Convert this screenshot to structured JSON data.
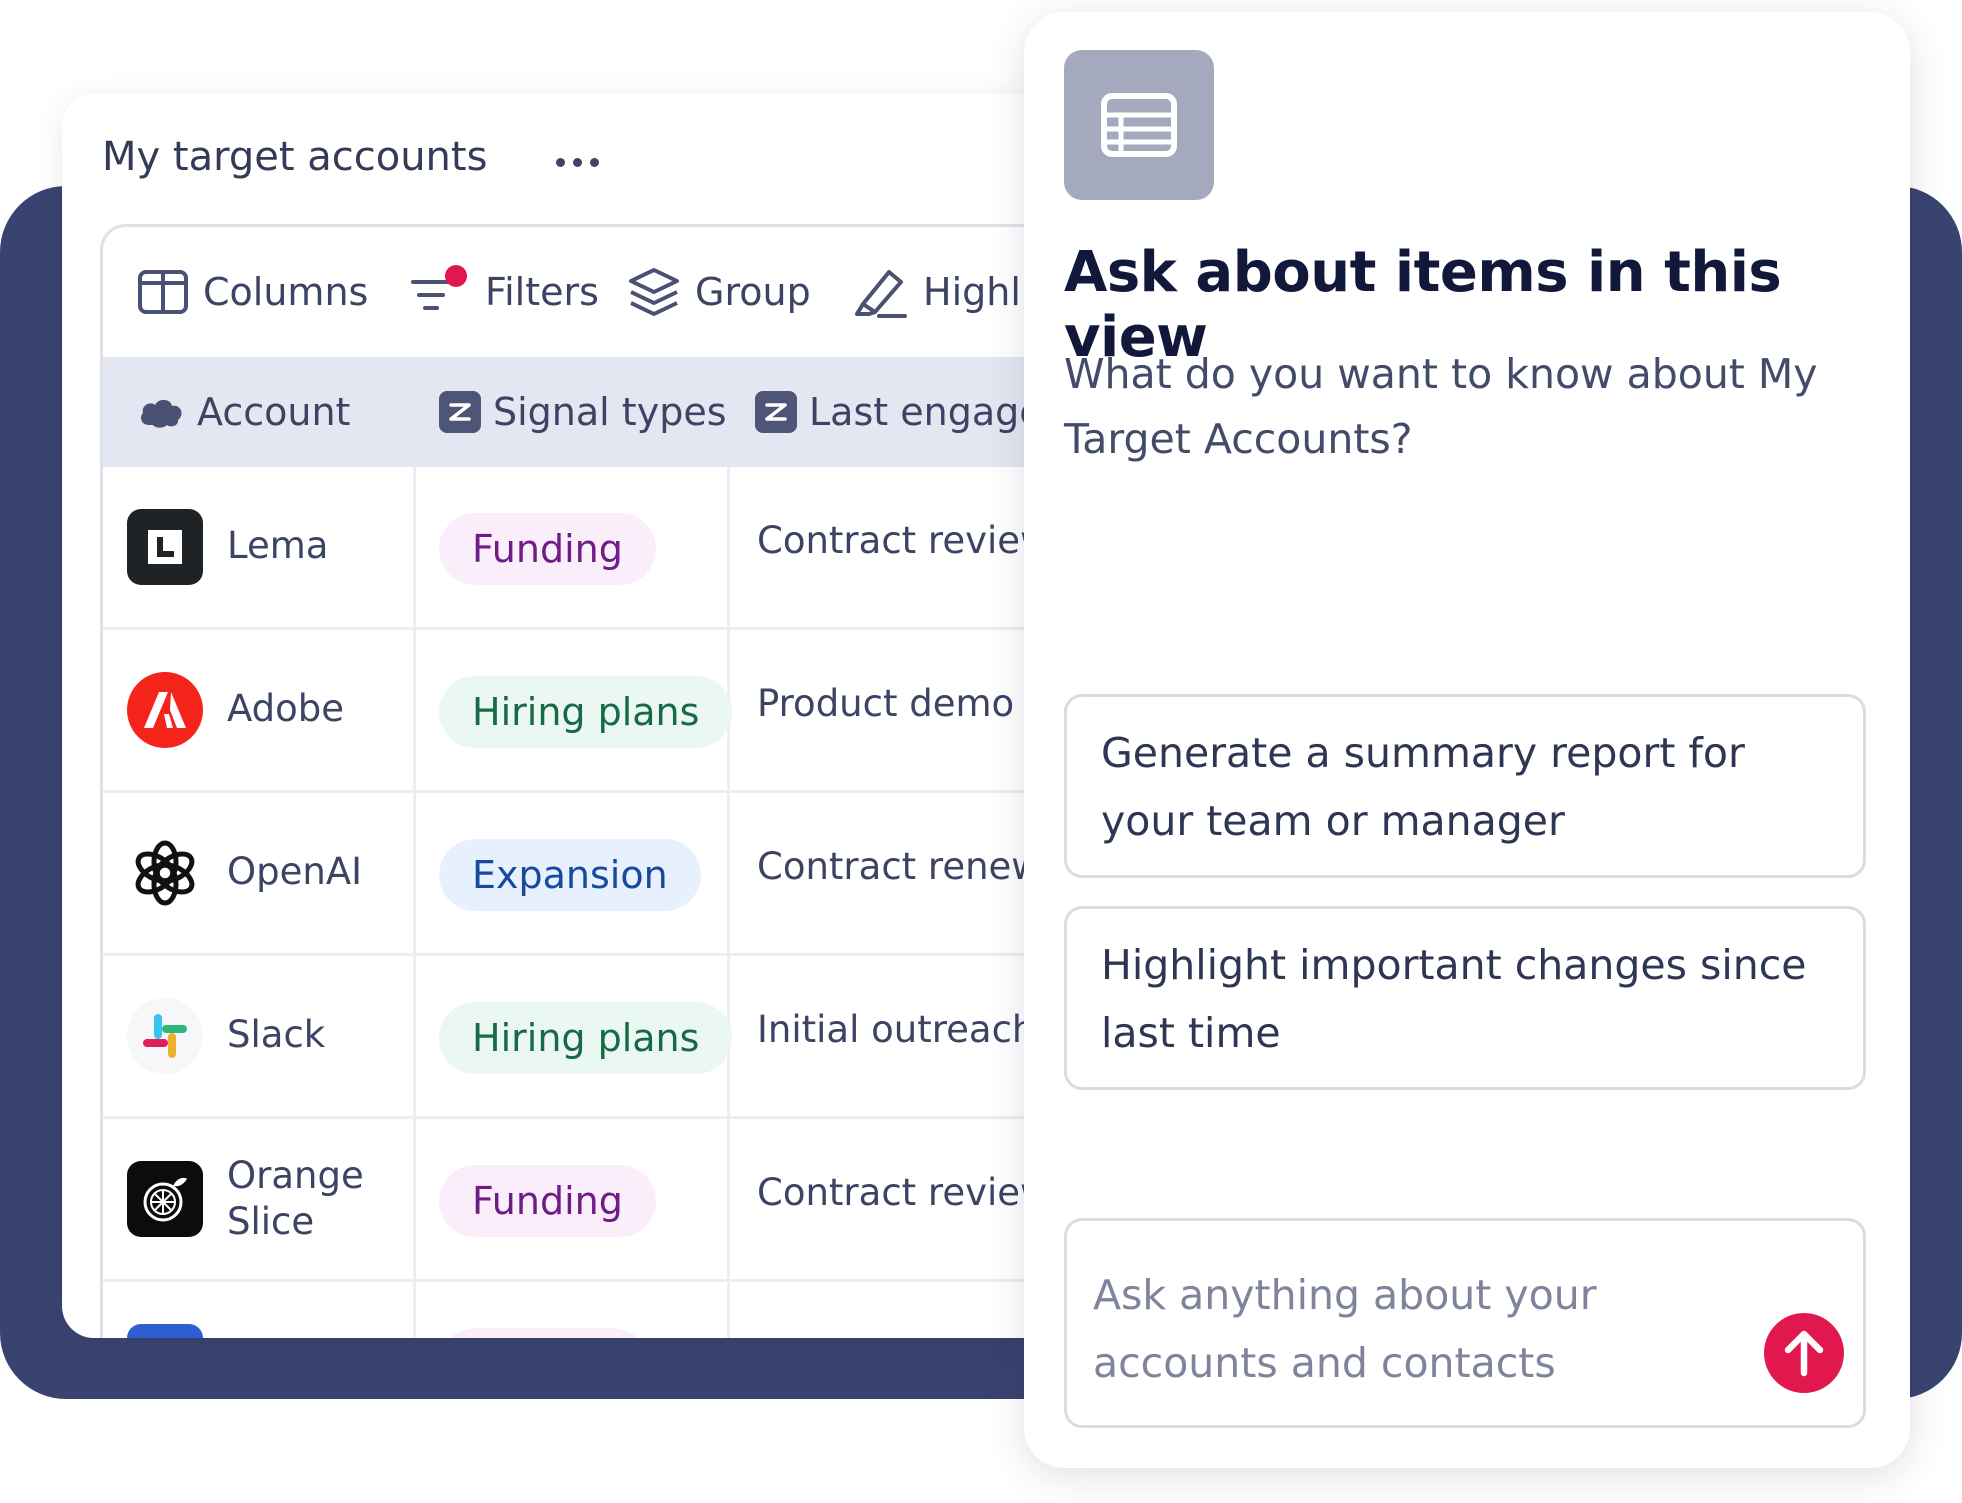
{
  "table_view": {
    "title": "My target accounts",
    "toolbar": {
      "columns_label": "Columns",
      "filters_label": "Filters",
      "group_label": "Group",
      "highlight_label": "Highli"
    },
    "headers": {
      "account": "Account",
      "signal_types": "Signal types",
      "last_engagement": "Last engage"
    },
    "rows": [
      {
        "account": "Lema",
        "signal": "Funding",
        "engagement": "Contract review",
        "logo": "lema-logo"
      },
      {
        "account": "Adobe",
        "signal": "Hiring plans",
        "engagement": "Product demo",
        "logo": "adobe-logo"
      },
      {
        "account": "OpenAI",
        "signal": "Expansion",
        "engagement": "Contract renewa",
        "logo": "openai-logo"
      },
      {
        "account": "Slack",
        "signal": "Hiring plans",
        "engagement": "Initial outreach",
        "logo": "slack-logo"
      },
      {
        "account": "Orange Slice",
        "signal": "Funding",
        "engagement": "Contract review",
        "logo": "orange-slice-logo"
      }
    ]
  },
  "ai_panel": {
    "title": "Ask about items in this view",
    "subtitle": "What do you want to know about My Target Accounts?",
    "suggestions": [
      "Generate a summary report for your team or manager",
      "Highlight important changes since last time"
    ],
    "input_placeholder": "Ask anything about your accounts and contacts"
  },
  "colors": {
    "backdrop": "#39436f",
    "send_button": "#e0184e",
    "funding_pill_bg": "#fbeefb",
    "funding_pill_text": "#6f1d86",
    "hiring_pill_bg": "#eaf8f1",
    "hiring_pill_text": "#17694a",
    "expansion_pill_bg": "#e7f1fd",
    "expansion_pill_text": "#174a9c"
  }
}
